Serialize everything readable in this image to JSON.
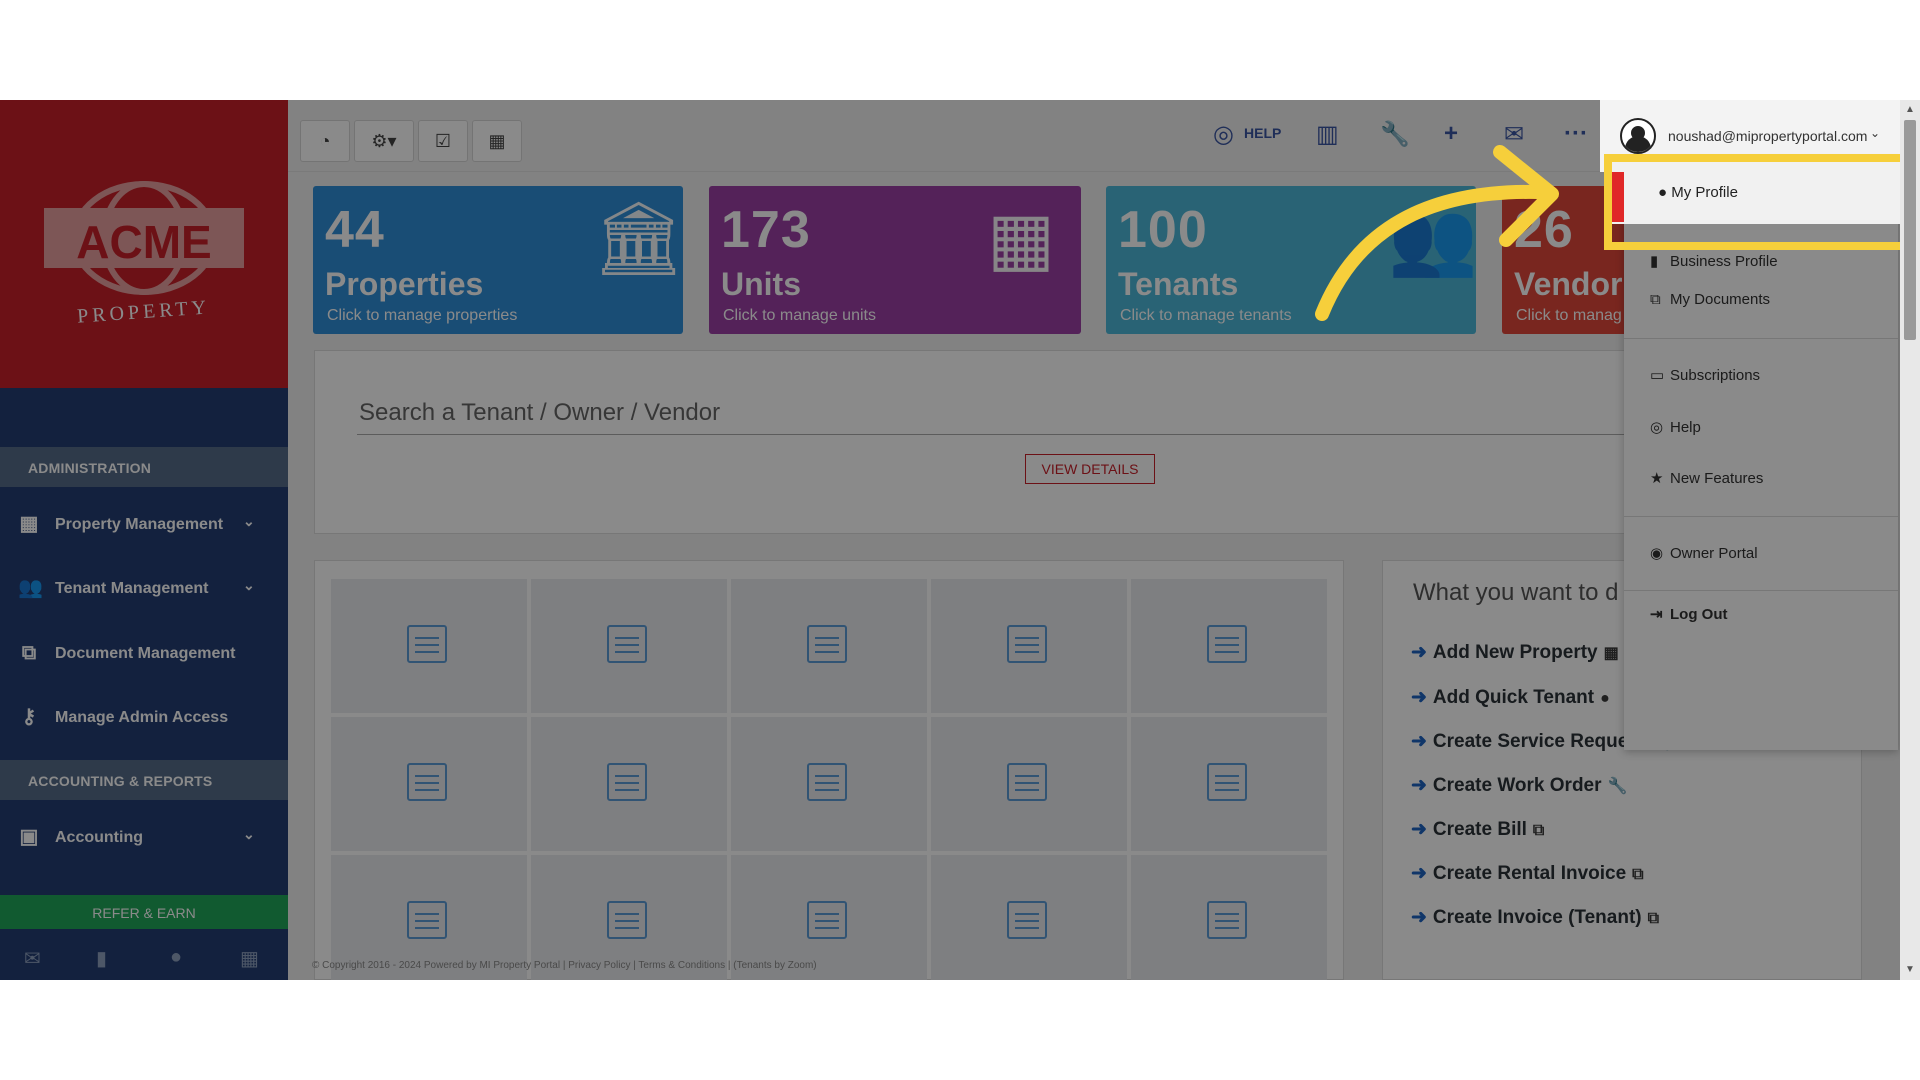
{
  "brand": {
    "name": "ACME",
    "tagline": "PROPERTY"
  },
  "sidebar": {
    "section_admin": "ADMINISTRATION",
    "section_accounting": "ACCOUNTING & REPORTS",
    "items": [
      {
        "label": "Property Management",
        "icon": "building-icon"
      },
      {
        "label": "Tenant Management",
        "icon": "users-icon"
      },
      {
        "label": "Document Management",
        "icon": "documents-icon"
      },
      {
        "label": "Manage Admin Access",
        "icon": "key-icon"
      },
      {
        "label": "Accounting",
        "icon": "money-icon"
      }
    ],
    "refer_label": "REFER & EARN"
  },
  "toolbar": {
    "help_label": "HELP",
    "more_label": "···"
  },
  "cards": [
    {
      "number": "44",
      "title": "Properties",
      "subtitle": "Click to manage properties",
      "color": "#2f8fd8",
      "icon": "bank-icon"
    },
    {
      "number": "173",
      "title": "Units",
      "subtitle": "Click to manage units",
      "color": "#9b3fa5",
      "icon": "apartment-icon"
    },
    {
      "number": "100",
      "title": "Tenants",
      "subtitle": "Click to manage tenants",
      "color": "#4cb8d8",
      "icon": "tenants-icon"
    },
    {
      "number": "26",
      "title": "Vendor",
      "subtitle": "Click to manag",
      "color": "#e0463a",
      "icon": "vendor-icon"
    }
  ],
  "search": {
    "placeholder": "Search a Tenant / Owner / Vendor",
    "view_details_label": "VIEW DETAILS"
  },
  "quick_actions": {
    "title": "What you want to d",
    "items": [
      "Add New Property",
      "Add Quick Tenant",
      "Create Service Request",
      "Create Work Order",
      "Create Bill",
      "Create Rental Invoice",
      "Create Invoice (Tenant)"
    ]
  },
  "footer": {
    "text": "© Copyright 2016 - 2024 Powered by MI Property Portal | Privacy Policy | Terms & Conditions | (Tenants by Zoom)"
  },
  "account": {
    "email": "noushad@mipropertyportal.com",
    "menu": [
      "My Profile",
      "Business Profile",
      "My Documents",
      "Subscriptions",
      "Help",
      "New Features",
      "Owner Portal",
      "Log Out"
    ]
  },
  "colors": {
    "highlight": "#f6cf3b",
    "sidebar_bg": "#233d73",
    "brand_red": "#c8202a"
  }
}
